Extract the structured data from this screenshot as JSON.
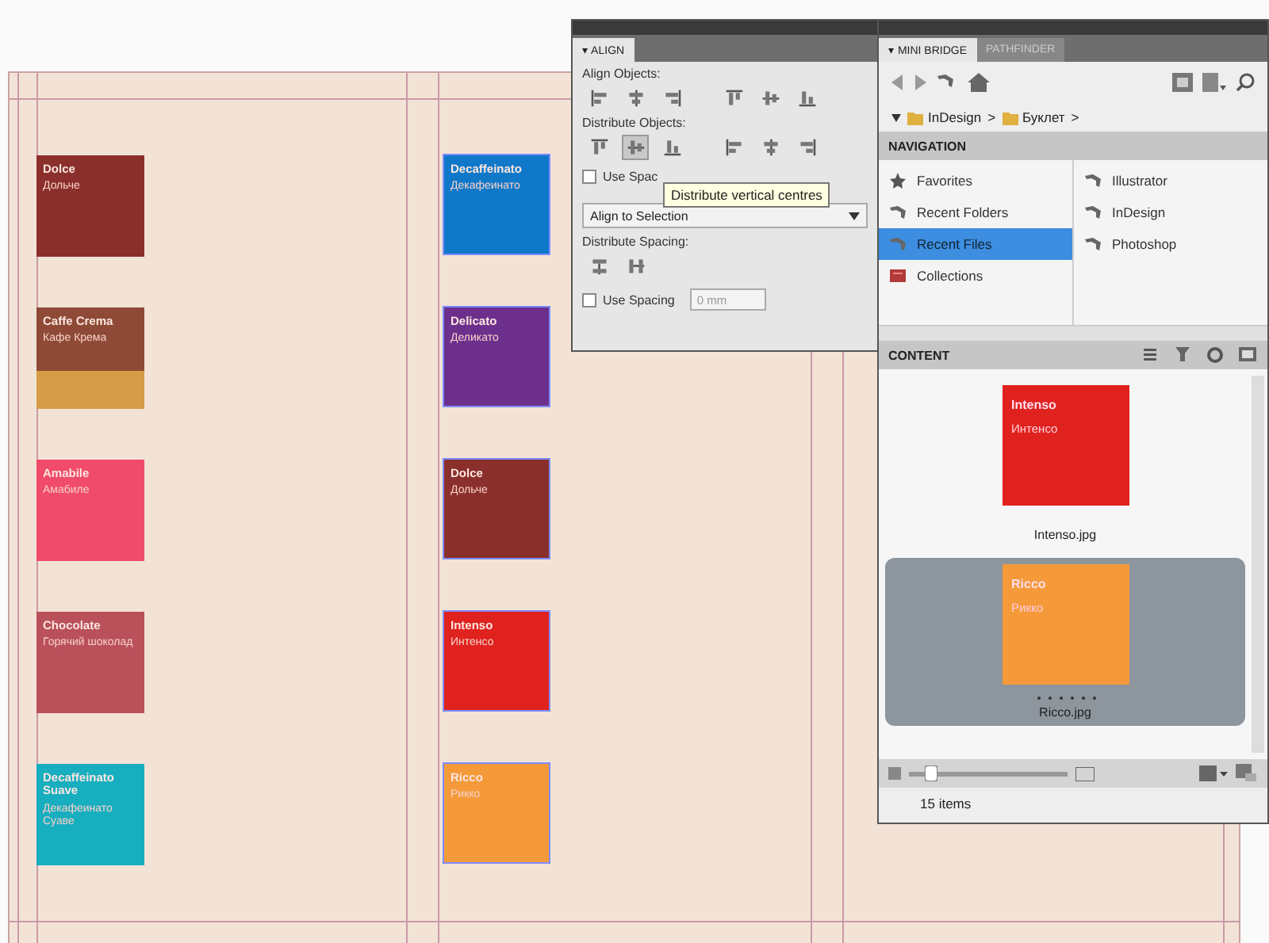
{
  "document": {
    "columns": [
      {
        "swatches": [
          {
            "name": "Dolce",
            "subtitle": "Дольче",
            "color": "#8b2f2c",
            "selected": false
          },
          {
            "name": "Caffe Crema",
            "subtitle": "Кафе Крема",
            "color": "#8e4a36",
            "bands": [
              {
                "color": "#d69c48"
              }
            ],
            "selected": false
          },
          {
            "name": "Amabile",
            "subtitle": "Амабиле",
            "color": "#f04b6a",
            "selected": false
          },
          {
            "name": "Chocolate",
            "subtitle": "Горячий шоколад",
            "color": "#b9505a",
            "selected": false
          },
          {
            "name": "Decaffeinato Suave",
            "subtitle": "Декафеинато Суаве",
            "color": "#17aebf",
            "selected": false
          }
        ]
      },
      {
        "swatches": [
          {
            "name": "Decaffeinato",
            "subtitle": "Декафеинато",
            "color": "#0f78c8",
            "selected": true
          },
          {
            "name": "Delicato",
            "subtitle": "Деликато",
            "color": "#6d2f8c",
            "selected": true
          },
          {
            "name": "Dolce",
            "subtitle": "Дольче",
            "color": "#8b2f2c",
            "selected": true
          },
          {
            "name": "Intenso",
            "subtitle": "Интенсо",
            "color": "#e0221e",
            "selected": true
          },
          {
            "name": "Ricco",
            "subtitle": "Рикко",
            "color": "#f59a3a",
            "selected": true
          }
        ]
      }
    ]
  },
  "align_panel": {
    "tab": "▾ ALIGN",
    "align_objects": {
      "label": "Align Objects:",
      "buttons": [
        {
          "kind": "left"
        },
        {
          "kind": "hcenter"
        },
        {
          "kind": "right"
        },
        {
          "kind": "top"
        },
        {
          "kind": "vcenter"
        },
        {
          "kind": "bottom"
        }
      ]
    },
    "distribute_objects": {
      "label": "Distribute Objects:",
      "buttons": [
        {
          "kind": "top",
          "hovered": false
        },
        {
          "kind": "vcenter",
          "hovered": true
        },
        {
          "kind": "bottom",
          "hovered": false
        },
        {
          "kind": "left",
          "hovered": false
        },
        {
          "kind": "hcenter",
          "hovered": false
        },
        {
          "kind": "right",
          "hovered": false
        }
      ]
    },
    "use_spacing_top": {
      "label": "Use Spac",
      "checked": false
    },
    "tooltip": "Distribute vertical centres",
    "align_to": "Align to Selection",
    "distribute_spacing": {
      "label": "Distribute Spacing:",
      "buttons": [
        {
          "kind": "vertical"
        },
        {
          "kind": "horizontal"
        }
      ]
    },
    "use_spacing_bottom": {
      "label": "Use Spacing",
      "checked": false,
      "value": "0 mm"
    }
  },
  "mini_bridge": {
    "tabs": [
      {
        "label": "▾ MINI BRIDGE",
        "selected": true
      },
      {
        "label": "PATHFINDER",
        "selected": false
      }
    ],
    "breadcrumbs": [
      "InDesign",
      "Буклет"
    ],
    "separator": ">",
    "navigation": {
      "title": "NAVIGATION",
      "left": [
        {
          "label": "Favorites",
          "kind": "star",
          "selected": false
        },
        {
          "label": "Recent Folders",
          "kind": "boomerang",
          "selected": false
        },
        {
          "label": "Recent Files",
          "kind": "boomerang",
          "selected": true
        },
        {
          "label": "Collections",
          "kind": "collection",
          "selected": false
        }
      ],
      "right": [
        {
          "label": "Illustrator"
        },
        {
          "label": "InDesign"
        },
        {
          "label": "Photoshop"
        }
      ]
    },
    "content": {
      "title": "CONTENT",
      "items": [
        {
          "filename": "Intenso.jpg",
          "name": "Intenso",
          "subtitle": "Интенсо",
          "color": "#e0221e",
          "selected": false
        },
        {
          "filename": "Ricco.jpg",
          "name": "Ricco",
          "subtitle": "Рикко",
          "color": "#f59a3a",
          "selected": true
        }
      ]
    },
    "status": "15 items"
  }
}
